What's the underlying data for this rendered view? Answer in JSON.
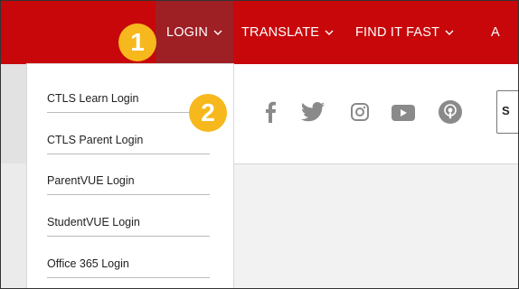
{
  "nav": {
    "login_label": "LOGIN",
    "translate_label": "TRANSLATE",
    "findit_label": "FIND IT FAST",
    "partial_label": "A",
    "chevron": "⌵"
  },
  "annotations": {
    "step1": "1",
    "step2": "2"
  },
  "dropdown": {
    "items": [
      {
        "label": "CTLS Learn Login"
      },
      {
        "label": "CTLS Parent Login"
      },
      {
        "label": "ParentVUE Login"
      },
      {
        "label": "StudentVUE Login"
      },
      {
        "label": "Office 365 Login"
      }
    ]
  },
  "social": {
    "icons": [
      "facebook-icon",
      "twitter-icon",
      "instagram-icon",
      "youtube-icon",
      "podcast-icon"
    ]
  },
  "search": {
    "partial_text": "S"
  },
  "colors": {
    "brand_red": "#c8070a",
    "active_red": "#9e1f24",
    "marker_yellow": "#f6b81c",
    "icon_gray": "#8a8a8a"
  }
}
